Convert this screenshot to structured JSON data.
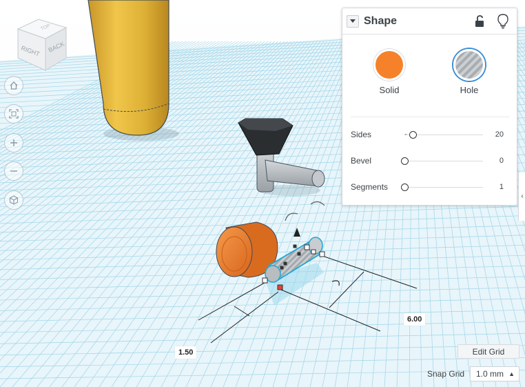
{
  "viewcube": {
    "faces": {
      "top": "TOP",
      "right": "RIGHT",
      "back": "BACK"
    }
  },
  "nav": {
    "buttons": [
      {
        "name": "home-view",
        "icon": "home-icon"
      },
      {
        "name": "fit-view",
        "icon": "fit-all-icon"
      },
      {
        "name": "zoom-in",
        "icon": "plus-icon"
      },
      {
        "name": "zoom-out",
        "icon": "minus-icon"
      },
      {
        "name": "perspective",
        "icon": "cube-icon"
      }
    ]
  },
  "inspector": {
    "title": "Shape",
    "solid_label": "Solid",
    "hole_label": "Hole",
    "solid_color": "#F5822A",
    "params": [
      {
        "label": "Sides",
        "value": "20",
        "level": 0.0,
        "minus": "-"
      },
      {
        "label": "Bevel",
        "value": "0",
        "level": 0.0
      },
      {
        "label": "Segments",
        "value": "1",
        "level": 0.0
      }
    ]
  },
  "dimensions": {
    "length": "6.00",
    "diameter": "1.50"
  },
  "grid": {
    "edit_label": "Edit Grid",
    "snap_label": "Snap Grid",
    "snap_value": "1.0 mm"
  },
  "colors": {
    "grid_line": "#8ecfe6",
    "grid_bg": "#e9f6fb",
    "pencil_yellow": "#e3b43a",
    "orange": "#f0802c",
    "funnel_black": "#2b2e31",
    "gray_part": "#b7bcc0",
    "selection_cyan": "#1ea7d6",
    "hole_stripe": "#a9adb1"
  }
}
